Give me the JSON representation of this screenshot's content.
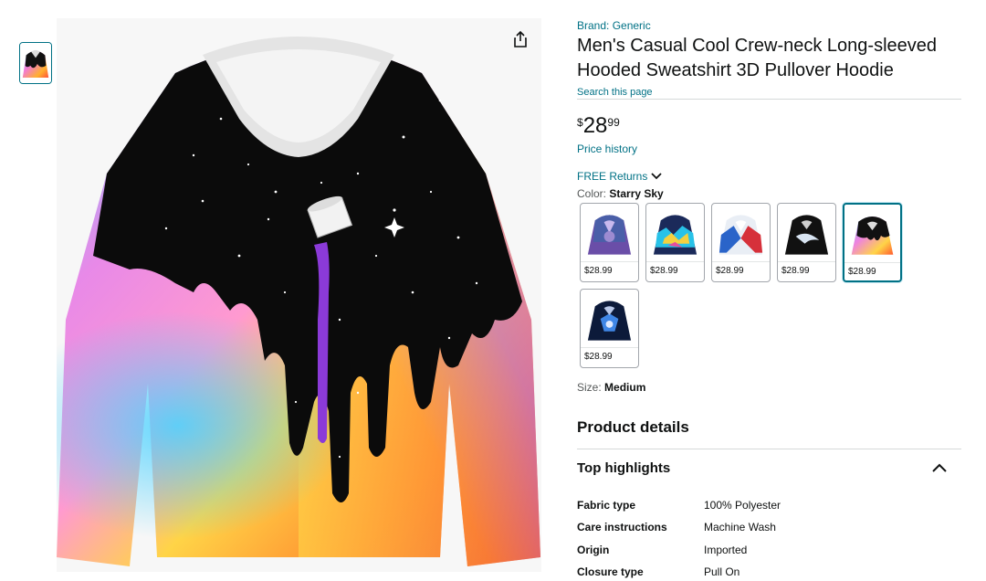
{
  "brand": "Brand: Generic",
  "title": "Men's Casual Cool Crew-neck Long-sleeved Hooded Sweatshirt 3D Pullover Hoodie",
  "search_link": "Search this page",
  "price": {
    "symbol": "$",
    "whole": "28",
    "fraction": "99"
  },
  "price_history": "Price history",
  "free_returns": "FREE Returns",
  "color": {
    "label": "Color:",
    "value": "Starry Sky"
  },
  "swatches": [
    {
      "price": "$28.99",
      "variant": "galaxy-wolf"
    },
    {
      "price": "$28.99",
      "variant": "neon-splash"
    },
    {
      "price": "$28.99",
      "variant": "red-blue-wolf"
    },
    {
      "price": "$28.99",
      "variant": "black-wave"
    },
    {
      "price": "$28.99",
      "variant": "starry-sky",
      "selected": true
    },
    {
      "price": "$28.99",
      "variant": "blue-wolf"
    }
  ],
  "size": {
    "label": "Size:",
    "value": "Medium"
  },
  "product_details": "Product details",
  "top_highlights": "Top highlights",
  "specs": [
    {
      "key": "Fabric type",
      "value": "100% Polyester"
    },
    {
      "key": "Care instructions",
      "value": "Machine Wash"
    },
    {
      "key": "Origin",
      "value": "Imported"
    },
    {
      "key": "Closure type",
      "value": "Pull On"
    }
  ],
  "colors": {
    "link": "#007185",
    "text": "#0f1111",
    "muted": "#565959",
    "divider": "#d5d9d9"
  },
  "icons": {
    "share": "share-icon",
    "chevron_down": "chevron-down-icon",
    "chevron_up": "chevron-up-icon"
  }
}
